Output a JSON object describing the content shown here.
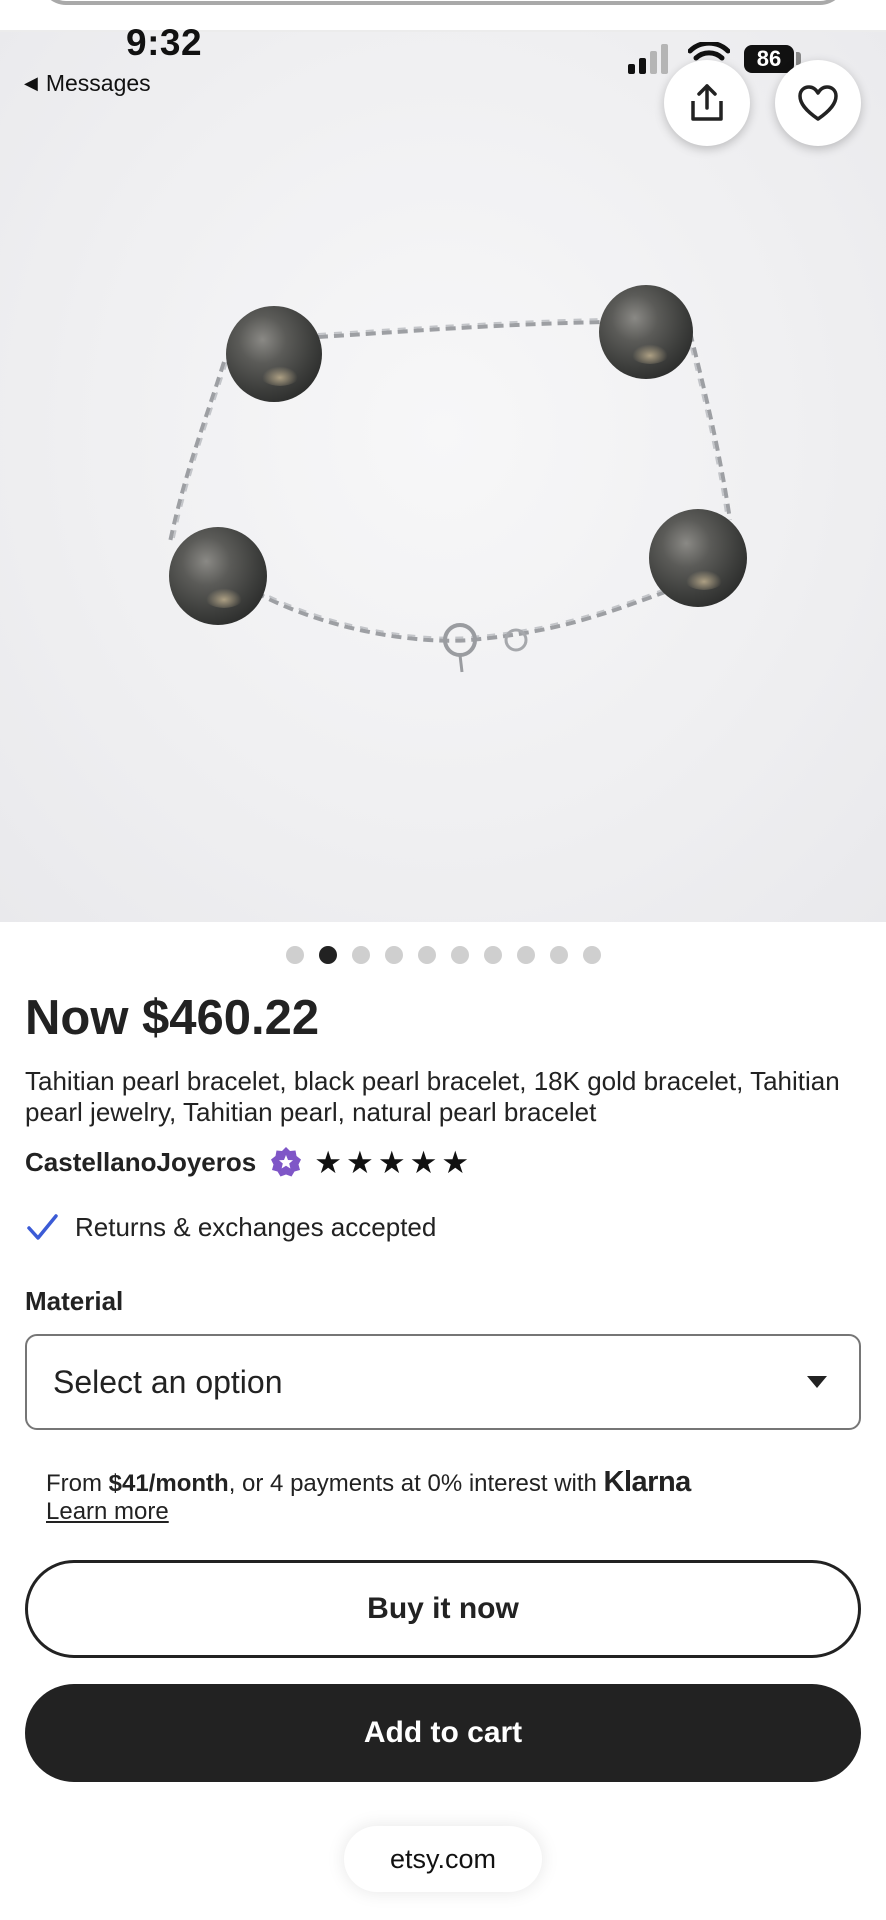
{
  "status_bar": {
    "time": "9:32",
    "back_label": "Messages",
    "battery": "86"
  },
  "hero": {
    "image_alt": "Tahitian pearl bracelet with four dark pearls on silver chain",
    "carousel_total": 10,
    "carousel_active": 2
  },
  "listing": {
    "price": "Now $460.22",
    "title": "Tahitian pearl bracelet, black pearl bracelet, 18K gold bracelet, Tahitian pearl jewelry, Tahitian pearl, natural pearl bracelet",
    "shop_name": "CastellanoJoyeros",
    "rating_stars": 5,
    "returns_text": "Returns & exchanges accepted"
  },
  "options": {
    "material_label": "Material",
    "select_placeholder": "Select an option"
  },
  "financing": {
    "prefix": "From ",
    "amount": "$41/month",
    "suffix": ", or 4 payments at 0% interest with ",
    "provider": "Klarna",
    "learn_more": "Learn more"
  },
  "actions": {
    "buy_now": "Buy it now",
    "add_to_cart": "Add to cart"
  },
  "browser": {
    "domain": "etsy.com"
  },
  "colors": {
    "primary_dark": "#222222",
    "star_seller_purple": "#7f56c7",
    "check_blue": "#3b5bd6"
  },
  "icons": {
    "share": "share-icon",
    "favorite": "heart-icon",
    "check": "check-icon",
    "star_seller": "star-seller-badge-icon",
    "dropdown": "caret-down-icon"
  }
}
